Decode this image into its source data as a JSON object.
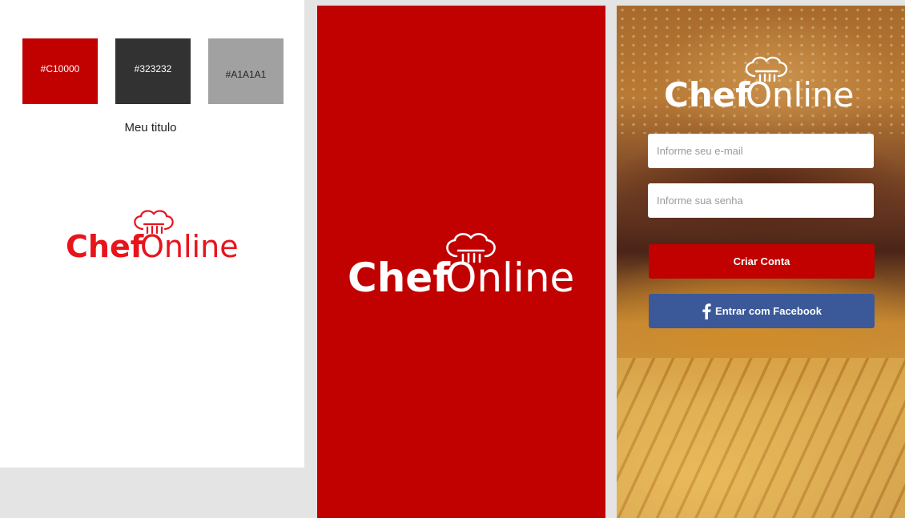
{
  "style_guide": {
    "colors": [
      {
        "label": "#C10000",
        "hex": "#C10000"
      },
      {
        "label": "#323232",
        "hex": "#323232"
      },
      {
        "label": "#A1A1A1",
        "hex": "#A1A1A1"
      }
    ],
    "title_sample": "Meu titulo"
  },
  "logo": {
    "part1": "Chef",
    "part2": "Online",
    "icon": "chef-hat-icon"
  },
  "login": {
    "email_placeholder": "Informe seu e-mail",
    "password_placeholder": "Informe sua senha",
    "create_account_label": "Criar Conta",
    "facebook_label": "Entrar com Facebook",
    "facebook_icon": "facebook-icon"
  },
  "theme": {
    "primary": "#C10000",
    "facebook": "#3b5998",
    "white": "#ffffff"
  }
}
